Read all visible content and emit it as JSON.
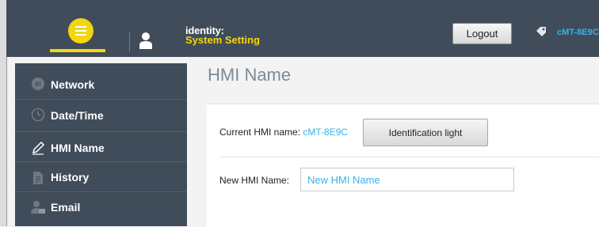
{
  "colors": {
    "topbar_bg": "#414c5a",
    "accent_yellow": "#f3d60f",
    "accent_blue": "#39b2ea",
    "content_bg": "#f3f3f3"
  },
  "header": {
    "identity_title": "identity:",
    "identity_subtitle": "System Setting",
    "logout_label": "Logout",
    "device_name": "cMT-8E9C"
  },
  "sidebar": {
    "items": [
      {
        "label": "Network",
        "icon": "network-ip-icon"
      },
      {
        "label": "Date/Time",
        "icon": "clock-icon"
      },
      {
        "label": "HMI Name",
        "icon": "pencil-icon",
        "selected": true
      },
      {
        "label": "History",
        "icon": "history-document-icon"
      },
      {
        "label": "Email",
        "icon": "email-user-icon"
      }
    ]
  },
  "main": {
    "title": "HMI Name",
    "current_label": "Current HMI name:",
    "current_value": "cMT-8E9C",
    "identification_button": "Identification light",
    "new_label": "New HMI Name:",
    "new_placeholder": "New HMI Name"
  }
}
